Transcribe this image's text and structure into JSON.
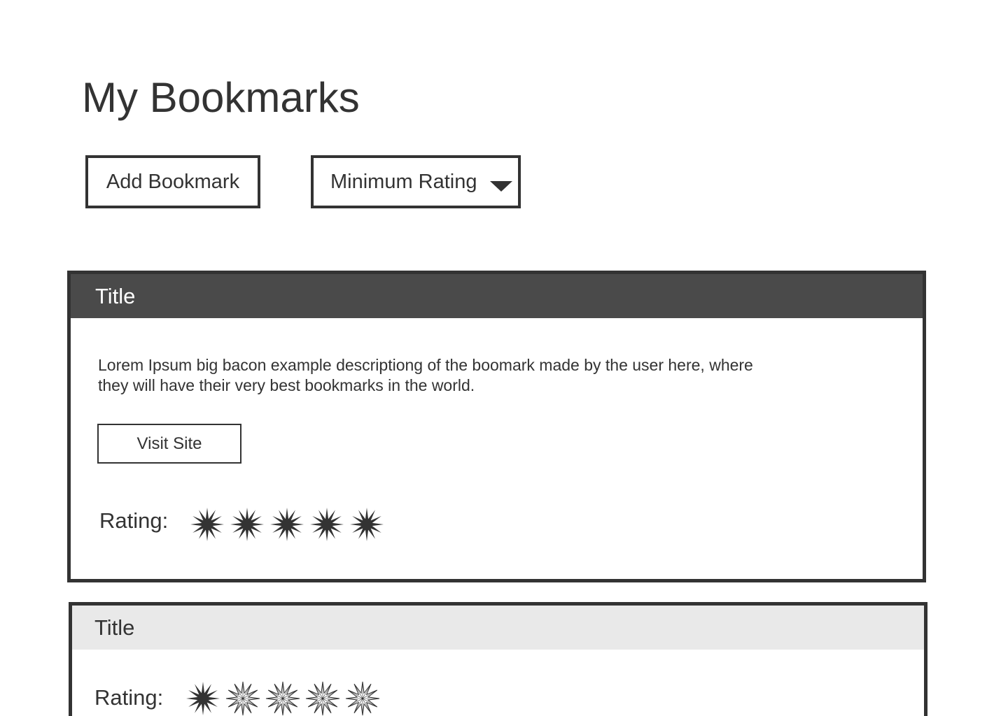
{
  "page": {
    "title": "My Bookmarks"
  },
  "toolbar": {
    "add_label": "Add Bookmark",
    "filter_label": "Minimum Rating",
    "filter_icon": "chevron-down-icon"
  },
  "bookmarks": [
    {
      "title": "Title",
      "expanded": true,
      "description": "Lorem Ipsum big bacon example descriptiong of the boomark made by the user here, where they will have their very best bookmarks in the world.",
      "visit_label": "Visit Site",
      "rating_label": "Rating:",
      "rating": 5,
      "max_rating": 5
    },
    {
      "title": "Title",
      "expanded": false,
      "rating_label": "Rating:",
      "rating": 1,
      "max_rating": 5
    }
  ],
  "colors": {
    "text": "#333333",
    "border": "#333333",
    "header_expanded_bg": "#4a4a4a",
    "header_expanded_text": "#ffffff",
    "header_collapsed_bg": "#e9e9e9",
    "star_filled": "#333333",
    "star_empty_stroke": "#333333"
  }
}
